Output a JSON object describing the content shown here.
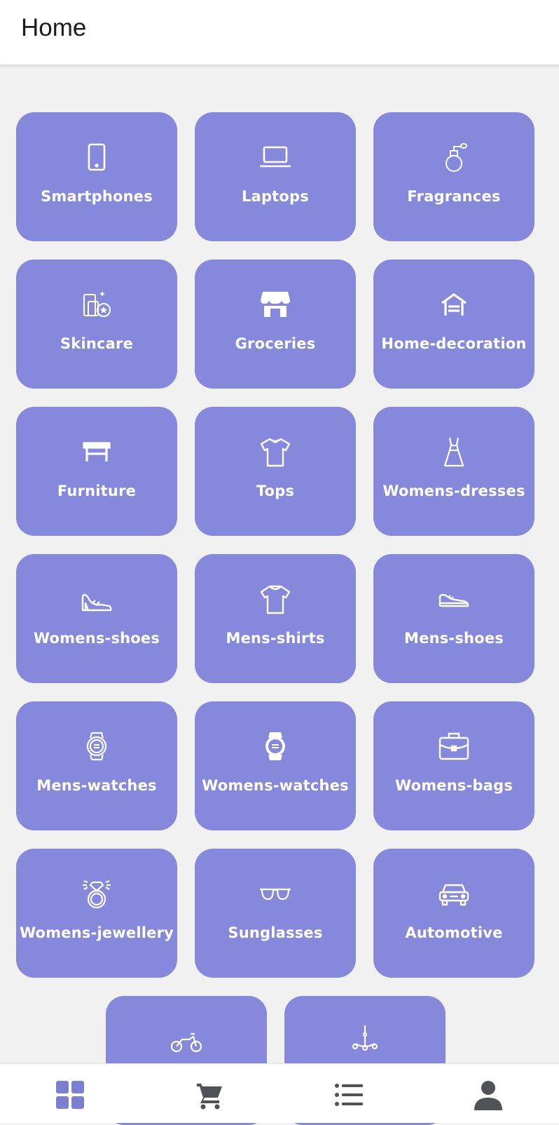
{
  "appbar": {
    "title": "Home"
  },
  "categories": [
    {
      "label": "Smartphones",
      "icon": "smartphone-icon"
    },
    {
      "label": "Laptops",
      "icon": "laptop-icon"
    },
    {
      "label": "Fragrances",
      "icon": "perfume-icon"
    },
    {
      "label": "Skincare",
      "icon": "skincare-icon"
    },
    {
      "label": "Groceries",
      "icon": "store-icon"
    },
    {
      "label": "Home-decoration",
      "icon": "house-icon"
    },
    {
      "label": "Furniture",
      "icon": "table-icon"
    },
    {
      "label": "Tops",
      "icon": "t-shirt-icon"
    },
    {
      "label": "Womens-dresses",
      "icon": "dress-icon"
    },
    {
      "label": "Womens-shoes",
      "icon": "high-heel-icon"
    },
    {
      "label": "Mens-shirts",
      "icon": "shirt-icon"
    },
    {
      "label": "Mens-shoes",
      "icon": "sneaker-icon"
    },
    {
      "label": "Mens-watches",
      "icon": "watch-icon"
    },
    {
      "label": "Womens-watches",
      "icon": "smartwatch-icon"
    },
    {
      "label": "Womens-bags",
      "icon": "bag-icon"
    },
    {
      "label": "Womens-jewellery",
      "icon": "ring-icon"
    },
    {
      "label": "Sunglasses",
      "icon": "sunglasses-icon"
    },
    {
      "label": "Automotive",
      "icon": "car-icon"
    },
    {
      "label": "",
      "icon": "motorcycle-icon"
    },
    {
      "label": "",
      "icon": "chandelier-icon"
    }
  ],
  "bottom_nav": {
    "items": [
      {
        "icon": "grid-icon",
        "active": true
      },
      {
        "icon": "cart-icon",
        "active": false
      },
      {
        "icon": "list-icon",
        "active": false
      },
      {
        "icon": "person-icon",
        "active": false
      }
    ],
    "active_color": "#7b7fd0",
    "inactive_color": "#4f5256"
  },
  "colors": {
    "tile": "#8689db",
    "background": "#f1f1f2",
    "appbar": "#ffffff"
  }
}
